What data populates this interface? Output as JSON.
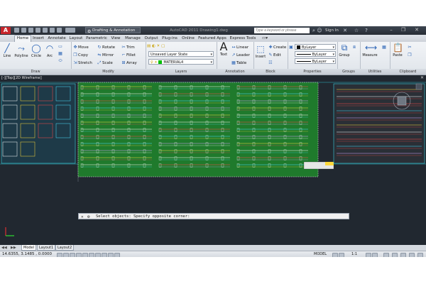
{
  "titlebar": {
    "logo": "A",
    "workspace": "Drafting & Annotation",
    "doc_title": "AutoCAD 2011  Drawing1.dwg",
    "search_placeholder": "Type a keyword or phrase",
    "sign_in": "Sign In"
  },
  "tabs": [
    "Home",
    "Insert",
    "Annotate",
    "Layout",
    "Parametric",
    "View",
    "Manage",
    "Output",
    "Plug-ins",
    "Online",
    "Featured Apps",
    "Express Tools"
  ],
  "ribbon": {
    "draw": {
      "title": "Draw",
      "line": "Line",
      "polyline": "Polyline",
      "circle": "Circle",
      "arc": "Arc"
    },
    "modify": {
      "title": "Modify",
      "move": "Move",
      "rotate": "Rotate",
      "trim": "Trim",
      "copy": "Copy",
      "mirror": "Mirror",
      "fillet": "Fillet",
      "stretch": "Stretch",
      "scale": "Scale",
      "array": "Array"
    },
    "layers": {
      "title": "Layers",
      "layer_state": "Unsaved Layer State",
      "current_layer": "MATERIAL4"
    },
    "annotation": {
      "title": "Annotation",
      "text": "Text",
      "linear": "Linear",
      "leader": "Leader",
      "table": "Table"
    },
    "block": {
      "title": "Block",
      "insert": "Insert",
      "create": "Create",
      "edit": "Edit"
    },
    "properties": {
      "title": "Properties",
      "color": "ByLayer",
      "linetype": "ByLayer",
      "lineweight": "ByLayer"
    },
    "groups": {
      "title": "Groups",
      "group": "Group"
    },
    "utilities": {
      "title": "Utilities",
      "measure": "Measure"
    },
    "clipboard": {
      "title": "Clipboard",
      "paste": "Paste"
    }
  },
  "viewport": {
    "label": "[-][Top][2D Wireframe]"
  },
  "command_line": {
    "text": "Select objects: Specify opposite corner:"
  },
  "layout_tabs": [
    "Model",
    "Layout1",
    "Layout2"
  ],
  "status": {
    "coords": "14.6355,  3.1485 , 0.0000",
    "model": "MODEL",
    "scale": "1:1"
  },
  "colors": {
    "accent": "#2a63b5",
    "viewport_bg": "#212830",
    "selection": "#1f7a2c"
  }
}
